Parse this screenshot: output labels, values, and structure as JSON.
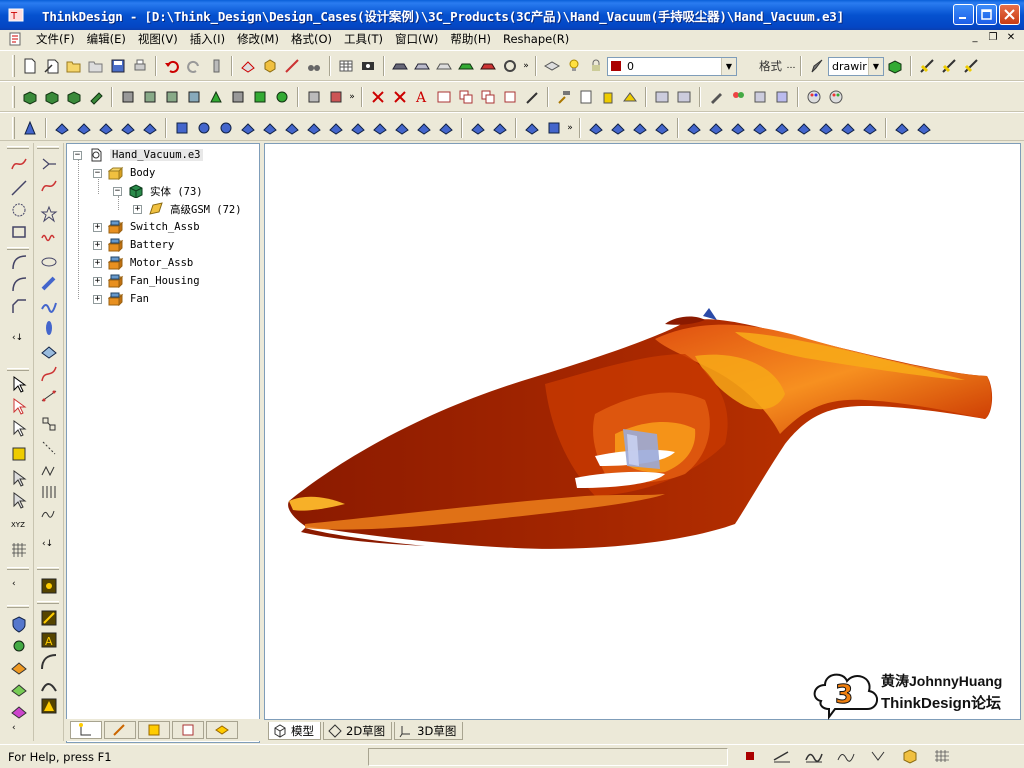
{
  "window": {
    "title": "ThinkDesign  - [D:\\Think_Design\\Design_Cases(设计案例)\\3C_Products(3C产品)\\Hand_Vacuum(手持吸尘器)\\Hand_Vacuum.e3]"
  },
  "menu": {
    "items": [
      "文件(F)",
      "编辑(E)",
      "视图(V)",
      "插入(I)",
      "修改(M)",
      "格式(O)",
      "工具(T)",
      "窗口(W)",
      "帮助(H)",
      "Reshape(R)"
    ]
  },
  "toolbar": {
    "layer_value": "0",
    "format_label": "格式",
    "style_value": "drawir"
  },
  "tree": {
    "root": "Hand_Vacuum.e3",
    "items": [
      {
        "label": "Body"
      },
      {
        "label": "实体 (73)"
      },
      {
        "label": "高级GSM (72)"
      },
      {
        "label": "Switch_Assb"
      },
      {
        "label": "Battery"
      },
      {
        "label": "Motor_Assb"
      },
      {
        "label": "Fan_Housing"
      },
      {
        "label": "Fan"
      }
    ]
  },
  "viewport_tabs": [
    "模型",
    "2D草图",
    "3D草图"
  ],
  "watermark": {
    "line1": "黄涛JohnnyHuang",
    "line2": "ThinkDesign论坛"
  },
  "status": {
    "help": "For Help, press F1"
  },
  "colors": {
    "titlebar": "#0552d0",
    "model_dark": "#8b1a00",
    "model_mid": "#e0560a",
    "model_light": "#f7a818"
  }
}
